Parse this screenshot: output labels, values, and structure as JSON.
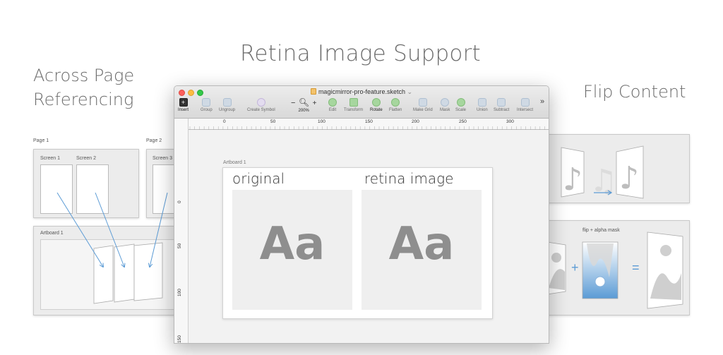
{
  "headings": {
    "center": "Retina Image Support",
    "left_line1": "Across Page",
    "left_line2": "Referencing",
    "right": "Flip Content"
  },
  "left_demo": {
    "page1_label": "Page 1",
    "page2_label": "Page 2",
    "screen1_label": "Screen 1",
    "screen2_label": "Screen 2",
    "screen3_label": "Screen 3",
    "artboard_label": "Artboard 1"
  },
  "right_demo": {
    "flip_alpha_label": "flip + alpha mask",
    "plus": "+",
    "equals": "="
  },
  "window": {
    "title": "magicmirror-pro-feature.sketch",
    "title_chevron": "⌄",
    "toolbar": {
      "insert": "Insert",
      "group": "Group",
      "ungroup": "Ungroup",
      "create_symbol": "Create Symbol",
      "zoom_minus": "−",
      "zoom_plus": "+",
      "zoom_value": "200%",
      "edit": "Edit",
      "transform": "Transform",
      "rotate": "Rotate",
      "flatten": "Flatten",
      "make_grid": "Make Grid",
      "mask": "Mask",
      "scale": "Scale",
      "union": "Union",
      "subtract": "Subtract",
      "intersect": "Intersect",
      "more": "»"
    },
    "ruler_top": [
      "0",
      "50",
      "100",
      "150",
      "200",
      "250",
      "300"
    ],
    "ruler_left": [
      "0",
      "50",
      "100",
      "150"
    ],
    "artboard": {
      "name": "Artboard 1",
      "original_title": "original",
      "retina_title": "retina image",
      "glyph": "Aa"
    }
  },
  "colors": {
    "heading": "#6b6b6b",
    "accent_blue": "#5b9bd5",
    "traffic_red": "#fc605c",
    "traffic_yellow": "#fdbc40",
    "traffic_green": "#34c84a"
  }
}
